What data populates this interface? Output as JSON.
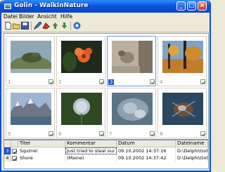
{
  "window": {
    "title": "Golin - WalkInNature"
  },
  "menu": {
    "items": [
      "Datei",
      "Bilder",
      "Ansicht",
      "Hilfe"
    ]
  },
  "toolbar": {
    "icons": [
      "new-file-icon",
      "open-folder-icon",
      "save-icon",
      "edit-icon",
      "delete-icon",
      "arrow-up-icon",
      "arrow-down-icon",
      "help-icon"
    ]
  },
  "thumbnails": [
    {
      "number": "1",
      "checked": true,
      "selected": false
    },
    {
      "number": "2",
      "checked": true,
      "selected": false
    },
    {
      "number": "3",
      "checked": true,
      "selected": true
    },
    {
      "number": "4",
      "checked": true,
      "selected": false
    },
    {
      "number": "5",
      "checked": true,
      "selected": false
    },
    {
      "number": "6",
      "checked": true,
      "selected": false
    },
    {
      "number": "7",
      "checked": true,
      "selected": false
    },
    {
      "number": "8",
      "checked": true,
      "selected": false
    }
  ],
  "table": {
    "columns": [
      "Titel",
      "Kommentar",
      "Datum",
      "Dateiname"
    ],
    "rows": [
      {
        "no": "3",
        "titel": "Squirrel",
        "kommentar": "Just tried to steal our picnic (Ma",
        "datum": "09.10.2002 14:37:16",
        "dateiname": "D:\\Delphi\\Golin"
      },
      {
        "no": "4",
        "titel": "Shore",
        "kommentar": "(Maine)",
        "datum": "09.10.2002 14:37:42",
        "dateiname": "D:\\Delphi\\Golin"
      }
    ]
  },
  "colors": {
    "titlebar": "#0A55DF",
    "selection": "#1C4FD4"
  }
}
